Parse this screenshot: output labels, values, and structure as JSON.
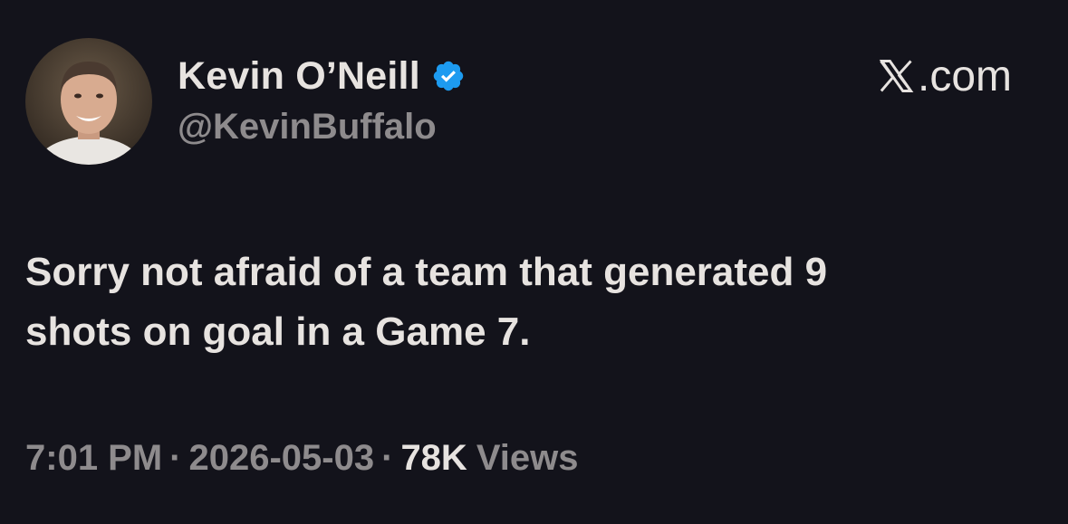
{
  "author": {
    "display_name": "Kevin O’Neill",
    "handle": "@KevinBuffalo",
    "verified": true,
    "avatar_icon": "person-avatar"
  },
  "brand": {
    "logo_icon": "x-logo-icon",
    "suffix": ".com"
  },
  "tweet": {
    "lines": [
      "Sorry not afraid of a team that generated 9",
      "shots on goal in a Game 7."
    ]
  },
  "meta": {
    "time": "7:01 PM",
    "separator": "·",
    "date": "2026-05-03",
    "views_count": "78K",
    "views_label": "Views"
  },
  "colors": {
    "background": "#13131b",
    "primary_text": "#e7e3e0",
    "secondary_text": "#8e8b8d",
    "verified_blue": "#1d9bf0"
  }
}
